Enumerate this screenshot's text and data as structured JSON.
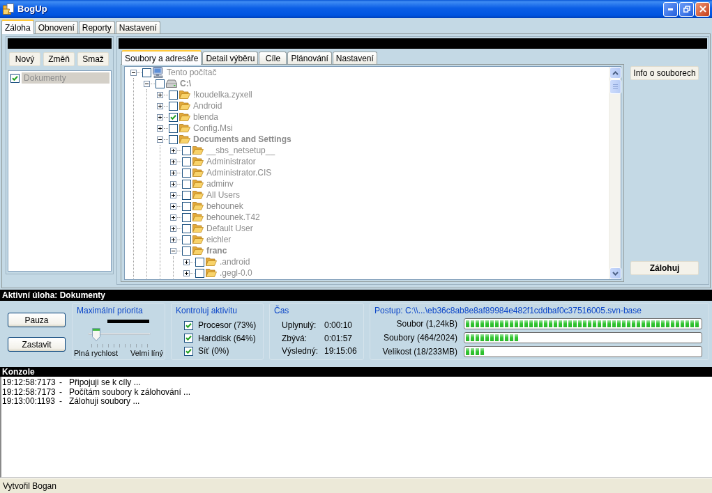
{
  "window": {
    "title": "BogUp"
  },
  "main_tabs": [
    {
      "label": "Záloha",
      "selected": true
    },
    {
      "label": "Obnovení",
      "selected": false
    },
    {
      "label": "Reporty",
      "selected": false
    },
    {
      "label": "Nastavení",
      "selected": false
    }
  ],
  "jobs": {
    "buttons": [
      "Nový",
      "Změň",
      "Smaž"
    ],
    "disabled": true,
    "items": [
      {
        "label": "Dokumenty",
        "checked": true,
        "selected": true
      }
    ]
  },
  "job_tabs": [
    {
      "label": "Soubory a adresáře",
      "selected": true
    },
    {
      "label": "Detail výběru",
      "selected": false
    },
    {
      "label": "Cíle",
      "selected": false
    },
    {
      "label": "Plánování",
      "selected": false
    },
    {
      "label": "Nastavení",
      "selected": false
    }
  ],
  "tree": {
    "disabled": true,
    "items": [
      {
        "kind": "computer",
        "label": "Tento počítač",
        "checked": false,
        "expanded": true,
        "bold": false,
        "children": [
          {
            "kind": "drive",
            "label": "C:\\",
            "checked": false,
            "expanded": true,
            "bold": true,
            "children": [
              {
                "kind": "folder",
                "label": "!koudelka.zyxell",
                "checked": false,
                "expanded": false,
                "bold": false
              },
              {
                "kind": "folder",
                "label": "Android",
                "checked": false,
                "expanded": false,
                "bold": false
              },
              {
                "kind": "folder",
                "label": "blenda",
                "checked": true,
                "expanded": false,
                "bold": false
              },
              {
                "kind": "folder",
                "label": "Config.Msi",
                "checked": false,
                "expanded": false,
                "bold": false
              },
              {
                "kind": "folder",
                "label": "Documents and Settings",
                "checked": false,
                "expanded": true,
                "bold": true,
                "children": [
                  {
                    "kind": "folder",
                    "label": "__sbs_netsetup__",
                    "checked": false,
                    "expanded": false,
                    "bold": false
                  },
                  {
                    "kind": "folder",
                    "label": "Administrator",
                    "checked": false,
                    "expanded": false,
                    "bold": false
                  },
                  {
                    "kind": "folder",
                    "label": "Administrator.CIS",
                    "checked": false,
                    "expanded": false,
                    "bold": false
                  },
                  {
                    "kind": "folder",
                    "label": "adminv",
                    "checked": false,
                    "expanded": false,
                    "bold": false
                  },
                  {
                    "kind": "folder",
                    "label": "All Users",
                    "checked": false,
                    "expanded": false,
                    "bold": false
                  },
                  {
                    "kind": "folder",
                    "label": "behounek",
                    "checked": false,
                    "expanded": false,
                    "bold": false
                  },
                  {
                    "kind": "folder",
                    "label": "behounek.T42",
                    "checked": false,
                    "expanded": false,
                    "bold": false
                  },
                  {
                    "kind": "folder",
                    "label": "Default User",
                    "checked": false,
                    "expanded": false,
                    "bold": false
                  },
                  {
                    "kind": "folder",
                    "label": "eichler",
                    "checked": false,
                    "expanded": false,
                    "bold": false
                  },
                  {
                    "kind": "folder",
                    "label": "franc",
                    "checked": false,
                    "expanded": true,
                    "bold": true,
                    "children": [
                      {
                        "kind": "folder",
                        "label": ".android",
                        "checked": false,
                        "expanded": false,
                        "bold": false
                      },
                      {
                        "kind": "folder",
                        "label": ".gegl-0.0",
                        "checked": false,
                        "expanded": false,
                        "bold": false
                      }
                    ]
                  }
                ]
              }
            ]
          }
        ]
      }
    ]
  },
  "side_buttons": {
    "info": "Info o souborech",
    "backup": "Zálohuj"
  },
  "active_task": "Aktivní úloha: Dokumenty",
  "task_buttons": [
    "Pauza",
    "Zastavit"
  ],
  "priority": {
    "title": "Maximální priorita",
    "level": 0.08,
    "min_label": "Plná rychlost",
    "max_label": "Velmi líný"
  },
  "activity": {
    "title": "Kontroluj aktivitu",
    "items": [
      {
        "label": "Procesor (73%)",
        "checked": true
      },
      {
        "label": "Harddisk (64%)",
        "checked": true
      },
      {
        "label": "Síť (0%)",
        "checked": true
      }
    ]
  },
  "time": {
    "title": "Čas",
    "rows": [
      {
        "label": "Uplynulý:",
        "value": "0:00:10"
      },
      {
        "label": "Zbývá:",
        "value": "0:01:57"
      },
      {
        "label": "Výsledný:",
        "value": "19:15:06"
      }
    ]
  },
  "progress": {
    "title": "Postup: C:\\\\...\\eb36c8ab8e8af89984e482f1cddbaf0c37516005.svn-base",
    "bars": [
      {
        "label": "Soubor (1,24kB)",
        "level": 1
      },
      {
        "label": "Soubory (464/2024)",
        "level": 0.23
      },
      {
        "label": "Velikost (18/233MB)",
        "level": 0.08
      }
    ]
  },
  "console": {
    "title": "Konzole",
    "lines": [
      {
        "time": "19:12:58:7173",
        "dash": "-",
        "message": "Připojuji se k cíly ..."
      },
      {
        "time": "19:12:58:7173",
        "dash": "-",
        "message": "Počítám soubory k zálohování ..."
      },
      {
        "time": "19:13:00:1193",
        "dash": "-",
        "message": "Zálohuji soubory ..."
      }
    ]
  },
  "status_bar": {
    "text": "Vytvořil Bogan"
  }
}
